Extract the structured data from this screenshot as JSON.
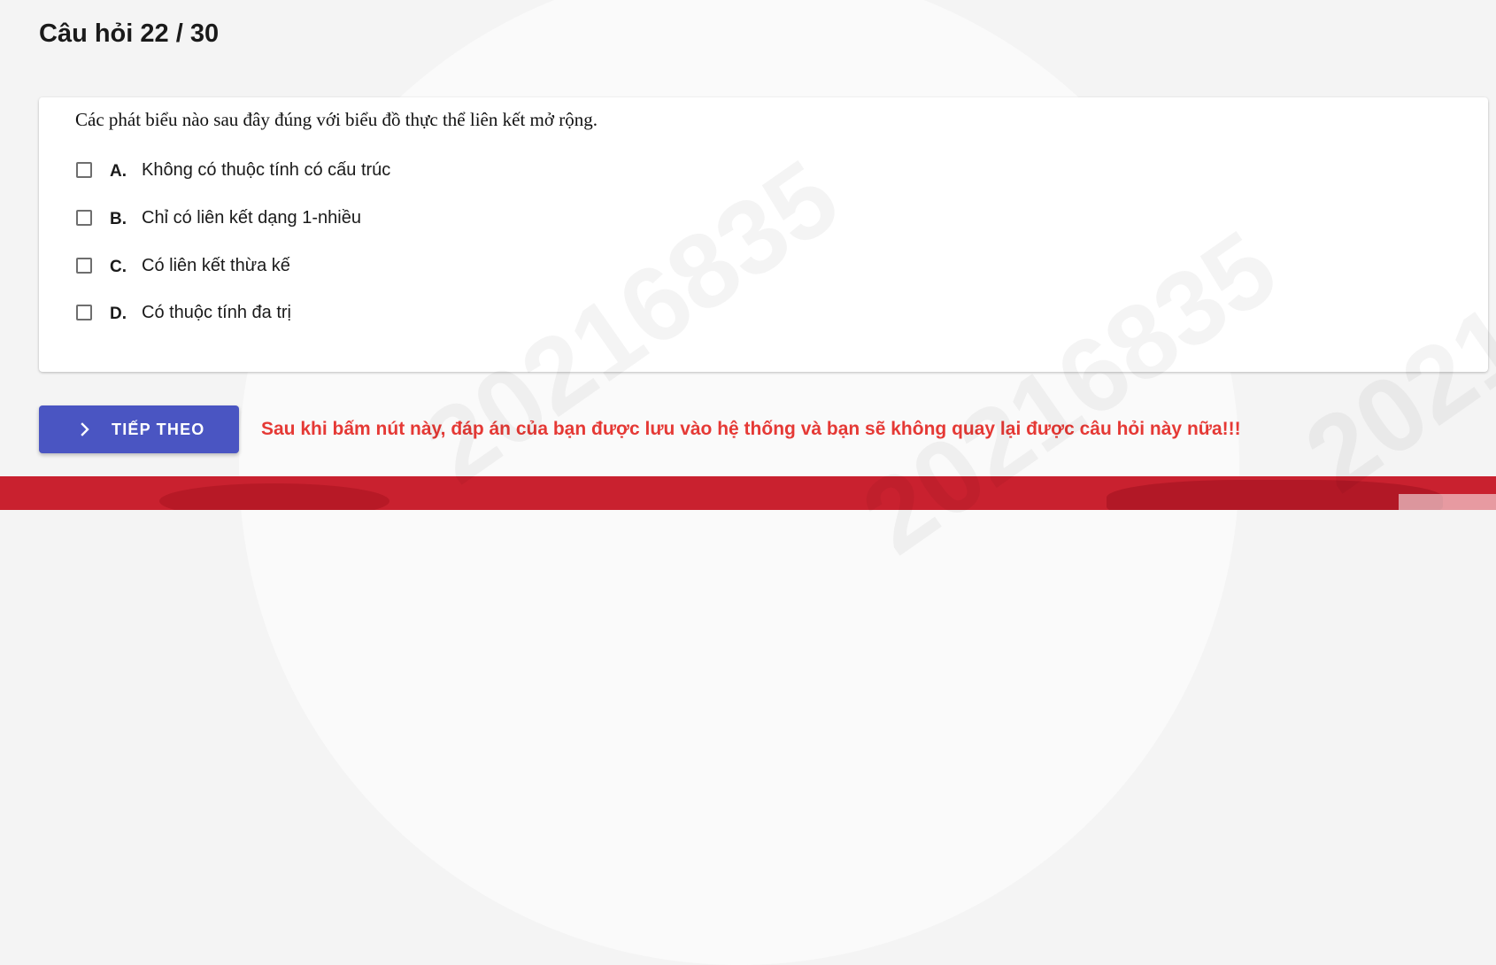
{
  "header": {
    "question_counter": "Câu hỏi 22 / 30"
  },
  "question": {
    "text": "Các phát biểu nào sau đây đúng với biểu đồ thực thể liên kết mở rộng.",
    "options": [
      {
        "letter": "A.",
        "text": "Không có thuộc tính có cấu trúc",
        "checked": false
      },
      {
        "letter": "B.",
        "text": "Chỉ có liên kết dạng 1-nhiều",
        "checked": false
      },
      {
        "letter": "C.",
        "text": "Có liên kết thừa kế",
        "checked": false
      },
      {
        "letter": "D.",
        "text": "Có thuộc tính đa trị",
        "checked": false
      }
    ]
  },
  "watermark": "20216835",
  "actions": {
    "next_label": "TIẾP THEO",
    "next_icon": "chevron-right-icon",
    "warning": "Sau khi bấm nút này, đáp án của bạn được lưu vào hệ thống và bạn sẽ không quay lại được câu hỏi này nữa!!!"
  },
  "colors": {
    "primary_button": "#4a55c2",
    "warning_text": "#e53935",
    "footer_band": "#c9212f",
    "card_bg": "#ffffff",
    "page_bg": "#f4f4f4"
  }
}
